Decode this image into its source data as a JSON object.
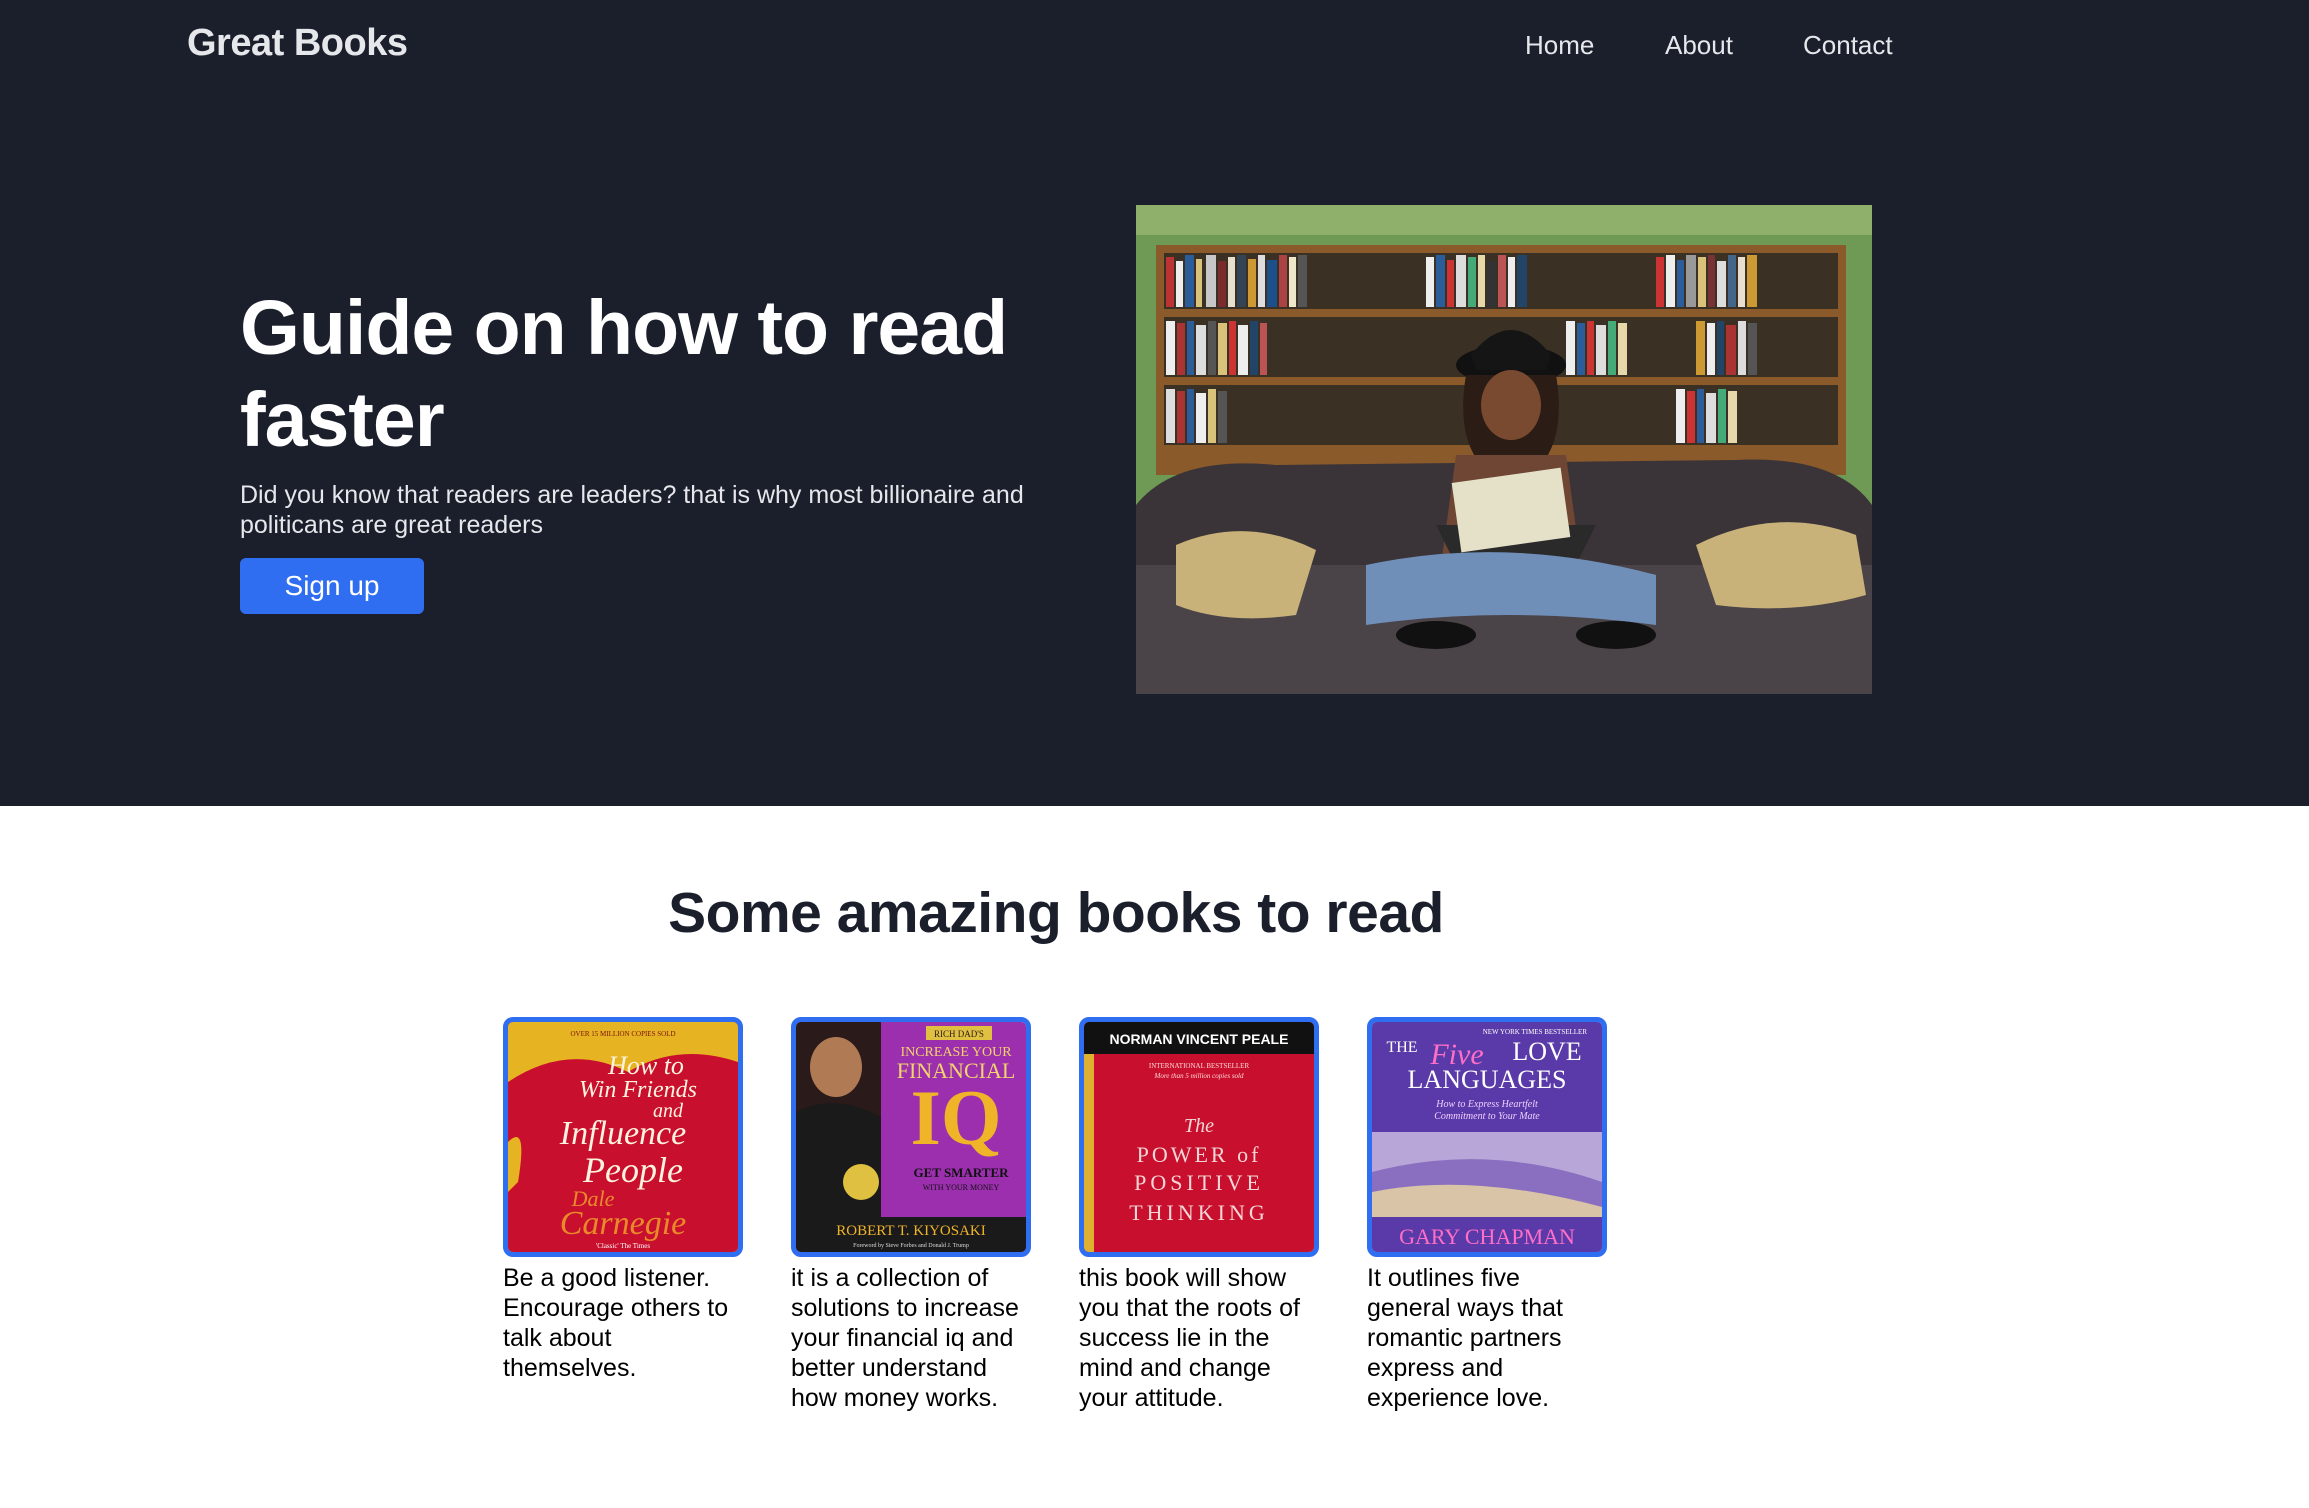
{
  "header": {
    "brand": "Great Books",
    "nav": [
      "Home",
      "About",
      "Contact"
    ]
  },
  "hero": {
    "title": "Guide on how to read faster",
    "subtitle": "Did you know that readers are leaders? that is why most billionaire and politicans are great readers",
    "signup_label": "Sign up",
    "image": "woman-reading-on-couch-photo"
  },
  "books_section": {
    "title": "Some amazing books to read",
    "books": [
      {
        "cover_lines": [
          "How to",
          "Win Friends",
          "and",
          "Influence",
          "People",
          "Dale",
          "Carnegie"
        ],
        "cover_top": "OVER 15 MILLION COPIES SOLD",
        "cover_bottom": "'Classic' The Times",
        "description": "Be a good listener. Encourage others to talk about themselves.",
        "color": "#c8102e"
      },
      {
        "cover_lines": [
          "INCREASE YOUR",
          "FINANCIAL",
          "IQ",
          "GET SMARTER",
          "WITH YOUR MONEY",
          "ROBERT T. KIYOSAKI"
        ],
        "cover_top": "RICH DAD'S",
        "cover_bottom": "Foreword by Steve Forbes and Donald J. Trump",
        "description": "it is a collection of solutions to increase your financial iq and better understand how money works.",
        "color": "#9b2fae"
      },
      {
        "cover_lines": [
          "NORMAN VINCENT PEALE",
          "INTERNATIONAL BESTSELLER",
          "More than 5 million copies sold",
          "The",
          "POWER of",
          "POSITIVE",
          "THINKING"
        ],
        "cover_top": "",
        "cover_bottom": "",
        "description": "this book will show you that the roots of success lie in the mind and change your attitude.",
        "color": "#c8102e"
      },
      {
        "cover_lines": [
          "NEW YORK TIMES BESTSELLER",
          "THE",
          "Five",
          "LOVE",
          "LANGUAGES",
          "How to Express Heartfelt",
          "Commitment to Your Mate",
          "GARY CHAPMAN"
        ],
        "cover_top": "",
        "cover_bottom": "",
        "description": "It outlines five general ways that romantic partners express and experience love.",
        "color": "#5a3aa8"
      }
    ]
  },
  "colors": {
    "hero_bg": "#1b1f2c",
    "accent": "#2f6ef0",
    "page_bg": "#ffffff"
  }
}
